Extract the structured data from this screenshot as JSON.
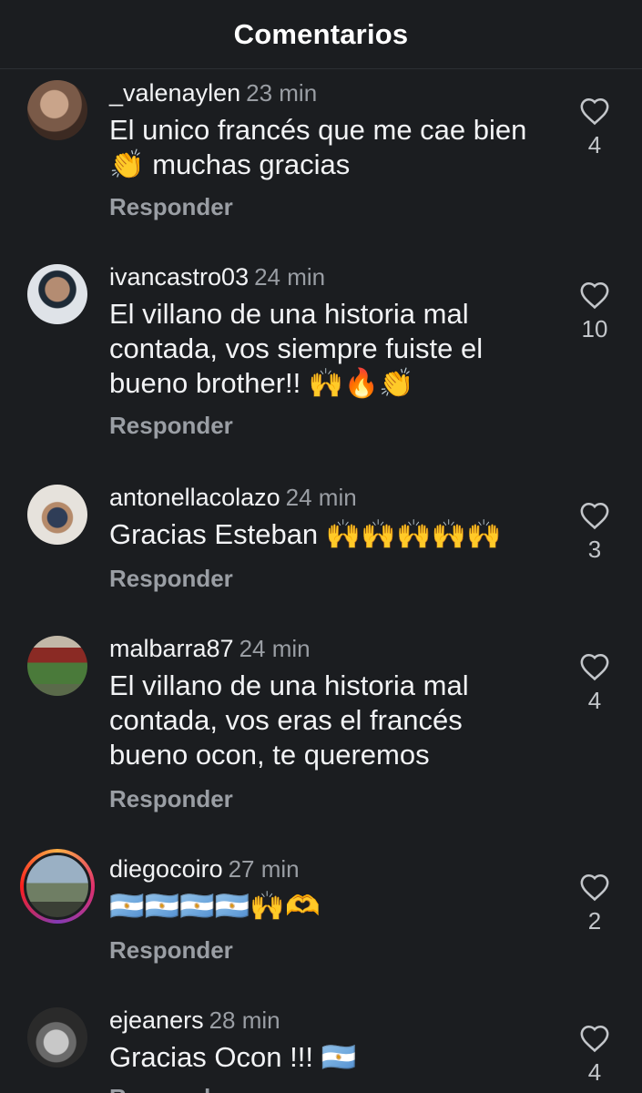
{
  "header": {
    "title": "Comentarios"
  },
  "comments": [
    {
      "username": "_valenaylen",
      "time": "23 min",
      "text": "El unico francés que me cae bien 👏 muchas gracias",
      "reply": "Responder",
      "likes": "4",
      "avatar_colors": [
        "#7a5a48",
        "#c9a48a",
        "#3c2a22"
      ]
    },
    {
      "username": "ivancastro03",
      "time": "24 min",
      "text": "El villano de una historia mal contada, vos siempre fuiste el bueno brother!! 🙌🔥👏",
      "reply": "Responder",
      "likes": "10",
      "avatar_colors": [
        "#dfe3e8",
        "#b48c72",
        "#1e2a36"
      ]
    },
    {
      "username": "antonellacolazo",
      "time": "24 min",
      "text": "Gracias Esteban 🙌🙌🙌🙌🙌",
      "reply": "Responder",
      "likes": "3",
      "avatar_colors": [
        "#e6e2dc",
        "#b58a6a",
        "#2f3d57"
      ]
    },
    {
      "username": "malbarra87",
      "time": "24 min",
      "text": "El villano de una historia mal contada, vos eras el francés bueno ocon, te queremos",
      "reply": "Responder",
      "likes": "4",
      "avatar_colors": [
        "#8a2a24",
        "#4a7a3a",
        "#c2b8a8"
      ]
    },
    {
      "username": "diegocoiro",
      "time": "27 min",
      "text": "🇦🇷🇦🇷🇦🇷🇦🇷🙌🫶",
      "reply": "Responder",
      "likes": "2",
      "avatar_colors": [
        "#9ab0c4",
        "#6f7e64",
        "#3a3f35"
      ]
    },
    {
      "username": "ejeaners",
      "time": "28 min",
      "text": "Gracias Ocon !!! 🇦🇷",
      "reply": "Responder",
      "likes": "4",
      "avatar_colors": [
        "#c8c8c8",
        "#6a6a6a",
        "#2a2a2a"
      ]
    }
  ]
}
